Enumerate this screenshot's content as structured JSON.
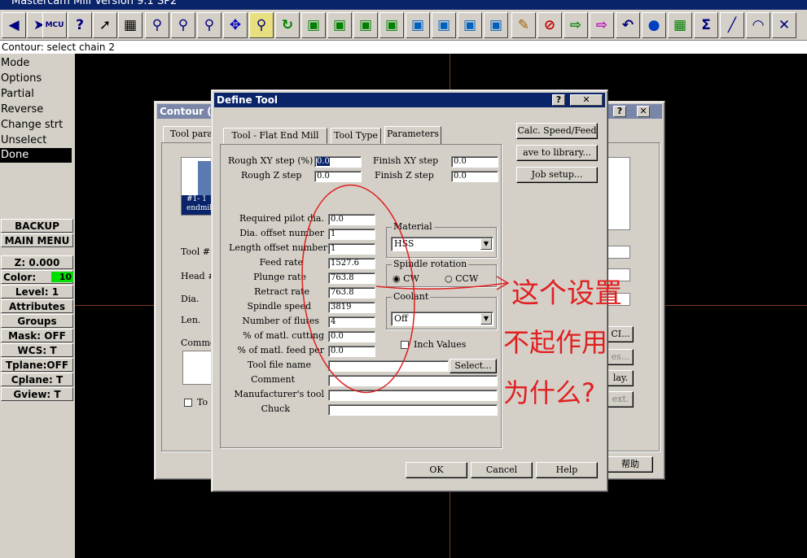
{
  "app": {
    "title": "Mastercam Mill Version 9.1 SP2"
  },
  "toolbar": {
    "icons": [
      "left-arrow-icon",
      "right-arrow-icon",
      "help-icon",
      "mcu-icon",
      "eye-icon",
      "calculator-icon",
      "analyze-icon",
      "zoom-icon",
      "zoom-window-icon",
      "zoom-out-icon",
      "pan-icon",
      "select-icon",
      "rotate-icon",
      "iso-view-icon",
      "top-view-icon",
      "front-view-icon",
      "side-view-icon",
      "cube-view-icon",
      "cube-front-icon",
      "cube-right-icon",
      "cube-iso-icon",
      "pencil-icon",
      "no-edit-icon",
      "transform-icon",
      "colors-icon",
      "undo-icon",
      "sphere-icon",
      "layers-icon",
      "sum-icon",
      "line-icon",
      "arc-icon",
      "trim-icon"
    ]
  },
  "prompt": {
    "text": "Contour: select chain 2"
  },
  "menu": {
    "items": [
      "Mode",
      "Options",
      "Partial",
      "Reverse",
      "Change strt",
      "Unselect",
      "Done"
    ],
    "selected": "Done",
    "backup": "BACKUP",
    "main_menu": "MAIN MENU",
    "z": "Z:  0.000",
    "color_label": "Color:",
    "color_value": "10",
    "level": "Level:  1",
    "attributes": "Attributes",
    "groups": "Groups",
    "mask": "Mask:  OFF",
    "wcs": "WCS:   T",
    "tplane": "Tplane:OFF",
    "cplane": "Cplane:  T",
    "gview": "Gview:   T"
  },
  "contour_dialog": {
    "title": "Contour (2D",
    "tab": "Tool para",
    "tool_item": "#1- 1",
    "tool_item2": "endmil",
    "tool_label": "Tool #",
    "head_label": "Head #",
    "dia_label": "Dia.",
    "len_label": "Len.",
    "comment_label": "Commen",
    "check_label": "To",
    "btn_ci": "CI...",
    "btn_es": "es...",
    "btn_lay": "lay.",
    "btn_ext": "ext.",
    "help": "帮助"
  },
  "define_tool": {
    "title": "Define Tool",
    "tabs": [
      "Tool - Flat End Mill",
      "Tool Type",
      "Parameters"
    ],
    "rough_xy_label": "Rough XY step (%)",
    "rough_xy": "0.0",
    "rough_z_label": "Rough Z step",
    "rough_z": "0.0",
    "finish_xy_label": "Finish XY step",
    "finish_xy": "0.0",
    "finish_z_label": "Finish Z step",
    "finish_z": "0.0",
    "params": [
      {
        "label": "Required pilot dia.",
        "value": "0.0"
      },
      {
        "label": "Dia. offset number",
        "value": "1"
      },
      {
        "label": "Length offset number",
        "value": "1"
      },
      {
        "label": "Feed rate",
        "value": "1527.6"
      },
      {
        "label": "Plunge rate",
        "value": "763.8"
      },
      {
        "label": "Retract rate",
        "value": "763.8"
      },
      {
        "label": "Spindle speed",
        "value": "3819"
      },
      {
        "label": "Number of flutes",
        "value": "4"
      },
      {
        "label": "% of matl. cutting",
        "value": "0.0"
      },
      {
        "label": "% of matl. feed per",
        "value": "0.0"
      }
    ],
    "tool_file_label": "Tool file name",
    "comment_label": "Comment",
    "manufacturer_label": "Manufacturer's tool",
    "chuck_label": "Chuck",
    "select_btn": "Select...",
    "material_group": "Material",
    "material_value": "HSS",
    "spindle_group": "Spindle rotation",
    "cw": "CW",
    "ccw": "CCW",
    "coolant_group": "Coolant",
    "coolant_value": "Off",
    "inch_values": "Inch Values",
    "calc_btn": "Calc. Speed/Feed",
    "save_btn": "ave to library...",
    "job_btn": "Job setup...",
    "ok": "OK",
    "cancel": "Cancel",
    "help": "Help"
  },
  "annotation": {
    "line1": "这个设置",
    "line2": "不起作用",
    "line3": "为什么?"
  }
}
